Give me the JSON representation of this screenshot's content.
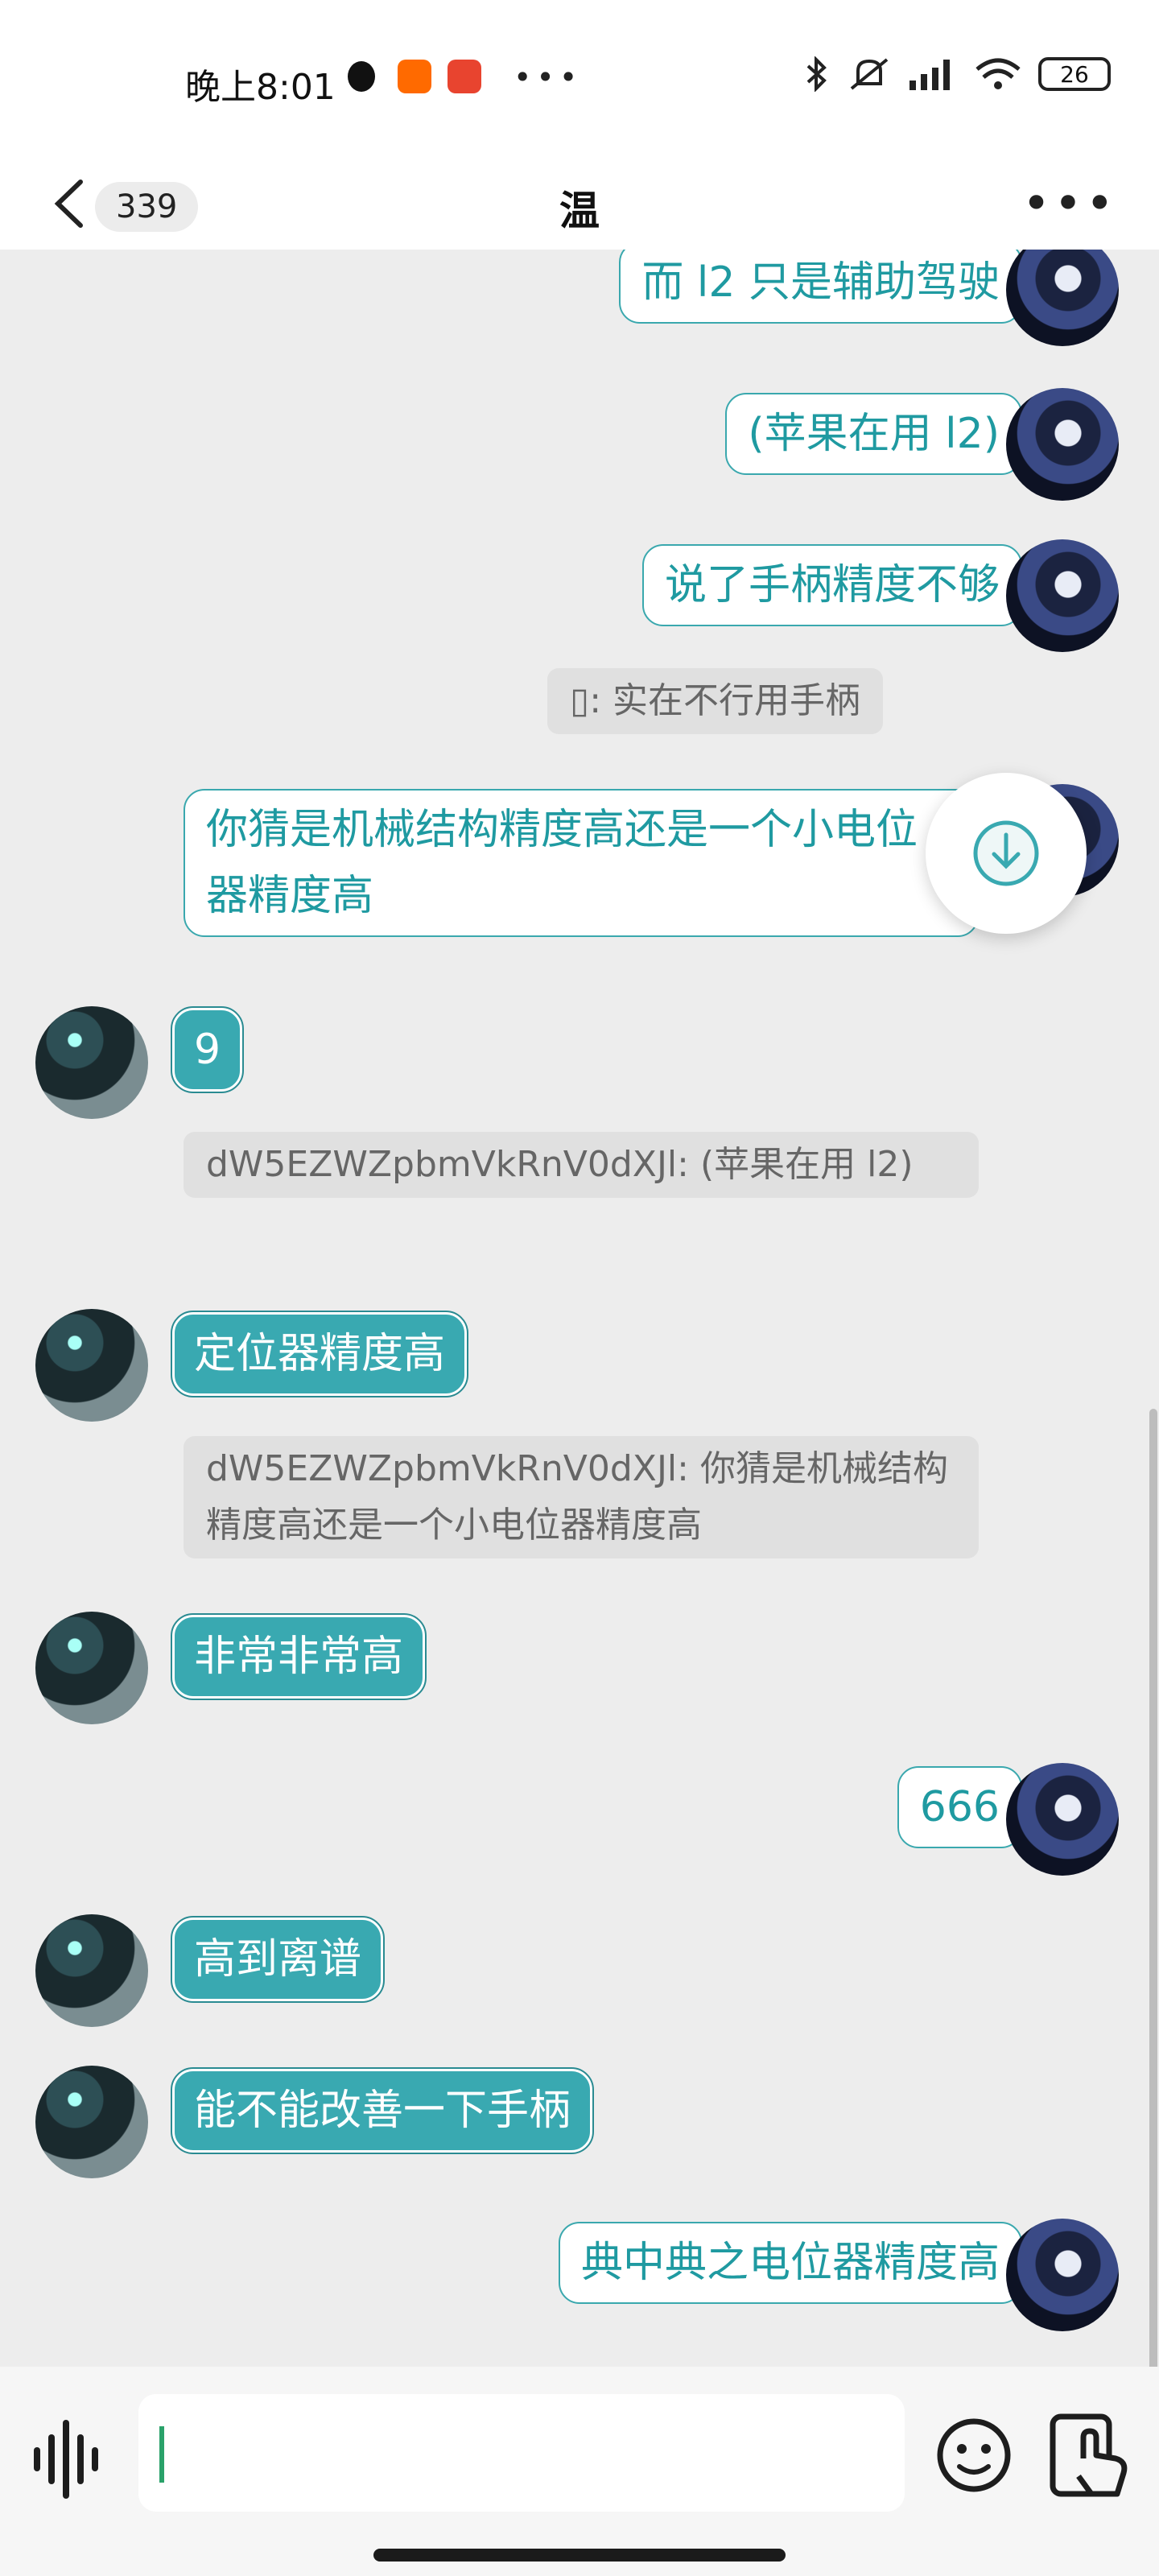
{
  "status_bar": {
    "time": "晚上8:01",
    "battery": "26"
  },
  "header": {
    "back_count": "339",
    "title": "温"
  },
  "messages": [
    {
      "side": "out",
      "text": "而 l2 只是辅助驾驶"
    },
    {
      "side": "out",
      "text": "(苹果在用 l2)"
    },
    {
      "side": "out",
      "text": "说了手柄精度不够"
    },
    {
      "quote": "▯: 实在不行用手柄"
    },
    {
      "side": "out",
      "text": "你猜是机械结构精度高还是一个小电位器精度高"
    },
    {
      "side": "in",
      "text": "9"
    },
    {
      "quote": "dW5EZWZpbmVkRnV0dXJl: (苹果在用 l2)"
    },
    {
      "side": "in",
      "text": "定位器精度高"
    },
    {
      "quote": "dW5EZWZpbmVkRnV0dXJl: 你猜是机械结构精度高还是一个小电位器精度高"
    },
    {
      "side": "in",
      "text": "非常非常高"
    },
    {
      "side": "out",
      "text": "666"
    },
    {
      "side": "in",
      "text": "高到离谱"
    },
    {
      "side": "in",
      "text": "能不能改善一下手柄"
    },
    {
      "side": "out",
      "text": "典中典之电位器精度高"
    }
  ],
  "input": {
    "value": ""
  },
  "colors": {
    "accent": "#39a9b1",
    "out_text": "#1f9aa1",
    "bg": "#ededed"
  },
  "icons": [
    "voice-icon",
    "emoji-icon",
    "gesture-icon",
    "scroll-to-bottom-icon",
    "back-icon",
    "more-icon"
  ]
}
